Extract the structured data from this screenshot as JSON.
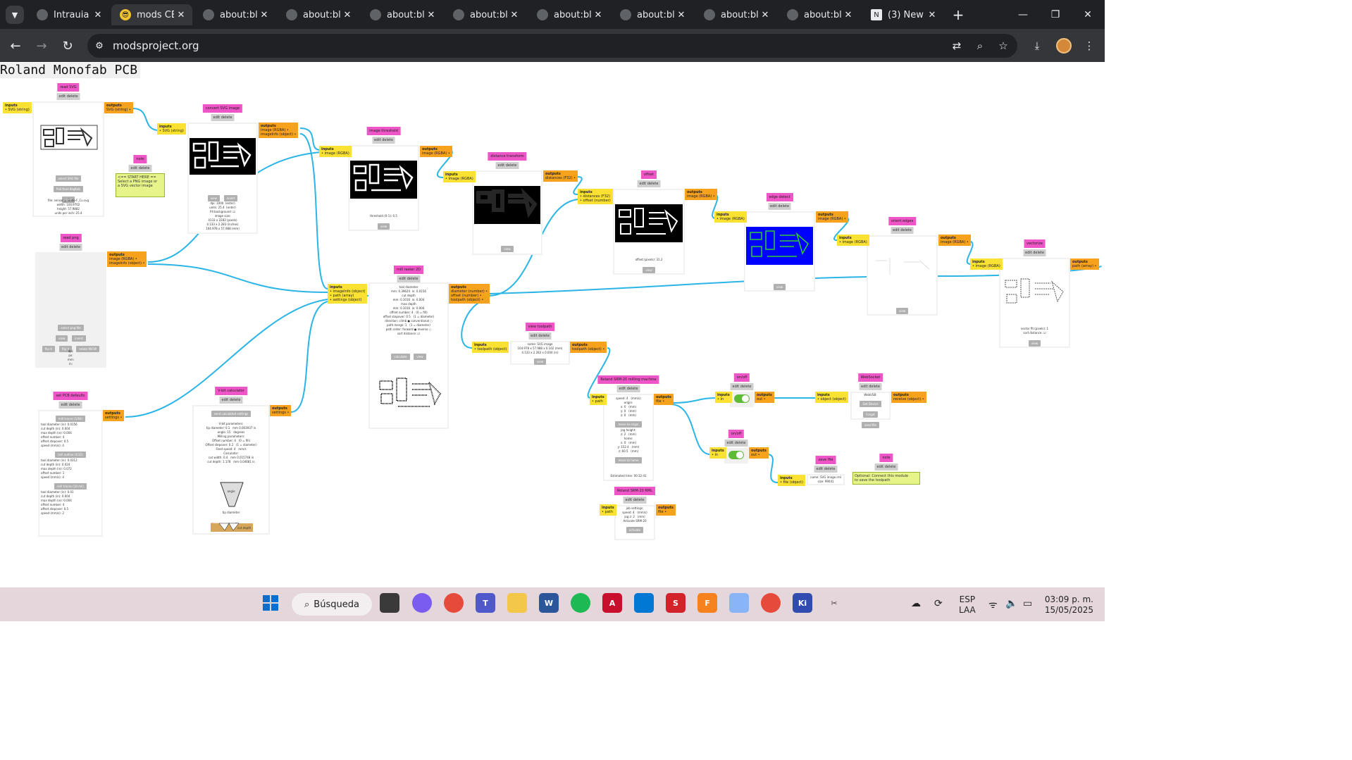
{
  "browser": {
    "tabs": [
      {
        "title": "Intrauia",
        "favicon": "globe-icon"
      },
      {
        "title": "mods CE",
        "favicon": "sunglasses-emoji-icon"
      },
      {
        "title": "about:bl",
        "favicon": "globe-icon"
      },
      {
        "title": "about:bl",
        "favicon": "globe-icon"
      },
      {
        "title": "about:bl",
        "favicon": "globe-icon"
      },
      {
        "title": "about:bl",
        "favicon": "globe-icon"
      },
      {
        "title": "about:bl",
        "favicon": "globe-icon"
      },
      {
        "title": "about:bl",
        "favicon": "globe-icon"
      },
      {
        "title": "about:bl",
        "favicon": "globe-icon"
      },
      {
        "title": "about:bl",
        "favicon": "globe-icon"
      },
      {
        "title": "(3) New",
        "favicon": "notion-icon"
      }
    ],
    "active_tab": 1,
    "url": "modsproject.org"
  },
  "page": {
    "title": "Roland Monofab PCB",
    "modules": {
      "read_svg": {
        "name": "read SVG",
        "edit": "edit delete",
        "in_hd": "inputs",
        "in_port": "• SVG (string)",
        "out_hd": "outputs",
        "out_port": "SVG (string) •",
        "btn1": "select SVG file",
        "btn2": "Pull from KegKab",
        "btn3": "view",
        "info": "file: sensor_y Sledo-F_Cu.svg\nwidth: 104.9702\nheight: 57.9882\nunits per inch: 25.4"
      },
      "note": {
        "name": "note",
        "edit": "edit delete",
        "text": "<== START HERE ==\nSelect a PNG image or\na SVG vector image"
      },
      "convert_svg": {
        "name": "convert SVG image",
        "edit": "edit delete",
        "in_hd": "inputs",
        "in_port": "• SVG (string)",
        "out_hd": "outputs",
        "out_port": "image (RGBA) •\nimageInfo (object) •",
        "btn1": "view",
        "btn2": "invert",
        "info": "dpi: 1000  (enter)\nunits: 25.4  (enter)\nfill background: ☑\nimage size:\n4133 x 2283 (pixels)\n4.133 x 2.283 (inches)\n104.978 x 57.988 (mm)"
      },
      "image_threshold": {
        "name": "image threshold",
        "edit": "edit delete",
        "in_hd": "inputs",
        "in_port": "• image (RGBA)",
        "out_hd": "outputs",
        "out_port": "image (RGBA) •",
        "info": "threshold (0-1): 0.5",
        "btn": "view"
      },
      "distance_transform": {
        "name": "distance transform",
        "edit": "edit delete",
        "in_hd": "inputs",
        "in_port": "• image (RGBA)",
        "out_hd": "outputs",
        "out_port": "distances (F32) •",
        "btn": "view"
      },
      "offset": {
        "name": "offset",
        "edit": "edit delete",
        "in_hd": "inputs",
        "in_port": "• distances (F32)\n• offset (number)",
        "out_hd": "outputs",
        "out_port": "image (RGBA) •",
        "info": "offset (pixels): 31.2",
        "btn": "view"
      },
      "edge_detect": {
        "name": "edge detect",
        "edit": "edit delete",
        "in_hd": "inputs",
        "in_port": "• image (RGBA)",
        "out_hd": "outputs",
        "out_port": "image (RGBA) •",
        "btn": "view"
      },
      "orient_edges": {
        "name": "orient edges",
        "edit": "edit delete",
        "in_hd": "inputs",
        "in_port": "• image (RGBA)",
        "out_hd": "outputs",
        "out_port": "image (RGBA) •",
        "btn": "view"
      },
      "vectorize": {
        "name": "vectorize",
        "edit": "edit delete",
        "in_hd": "inputs",
        "in_port": "• image (RGBA)",
        "out_hd": "outputs",
        "out_port": "path (array) •",
        "info": "vector fit (pixels): 1\nsort distance: ☑",
        "btn": "view"
      },
      "read_png": {
        "name": "read png",
        "edit": "edit delete",
        "out_hd": "outputs",
        "out_port": "image (RGBA) •\nimageInfo (object) •",
        "btn1": "select png file",
        "btn2": "view",
        "btn3": "invert",
        "btn4": "flip H",
        "btn5": "flip V",
        "btn6": "rotate 90CW",
        "info": "dpi:\npx:\nmm:\nin:"
      },
      "mill_raster": {
        "name": "mill raster 2D",
        "edit": "edit delete",
        "in_hd": "inputs",
        "in_port": "• imageInfo (object)\n• path (array)\n• settings (object)",
        "out_hd": "outputs",
        "out_port": "diameter (number) •\noffset (number) •\ntoolpath (object) •",
        "info": "tool diameter\nmm: 0.39624  in: 0.0156\ncut depth\nmm: 0.1016  in: 0.004\nmax depth\nmm: 0.1016  in: 0.004\noffset number: 4   (0 = fill)\noffset stepover: 0.5   (1 = diameter)\ndirection: climb ● conventional ○\npath merge: 1   (1 = diameter)\npath order: forward ● reverse ○\nsort distance: ☑",
        "btn1": "calculate",
        "btn2": "view"
      },
      "view_toolpath": {
        "name": "view toolpath",
        "edit": "edit delete",
        "in_hd": "inputs",
        "in_port": "• toolpath (object)",
        "out_hd": "outputs",
        "out_port": "toolpath (object) •",
        "info": "name: SVG image\n104.978 x 57.988 x 0.102 (mm)\n4.133 x 2.283 x 0.004 (in)",
        "btn": "view"
      },
      "set_pcb": {
        "name": "set PCB defaults",
        "edit": "edit delete",
        "out_hd": "outputs",
        "out_port": "settings •",
        "btn1": "mill traces (1/64)",
        "info1": "tool diameter (in): 0.0156\ncut depth (in): 0.004\nmax depth (in): 0.004\noffset number: 4\noffset stepover: 0.5\nspeed (mm/s): 4",
        "btn2": "mill outline (1/32)",
        "info2": "tool diameter (in): 0.0312\ncut depth (in): 0.024\nmax depth (in): 0.072\noffset number: 1\nspeed (mm/s): 4",
        "btn3": "mill traces (10 mil)",
        "info3": "tool diameter (in): 0.01\ncut depth (in): 0.004\nmax depth (in): 0.004\noffset number: 4\noffset stepover: 0.5\nspeed (mm/s): 2"
      },
      "vbit": {
        "name": "V-bit calculator",
        "edit": "edit delete",
        "out_hd": "outputs",
        "out_port": "settings •",
        "btn": "send calculated settings",
        "info": "V-bit parameters:\ntip diameter: 0.1   mm 0.003937 in\nangle: 15   degrees\nMilling parameters:\nOffset number: 4   (0 = fill)\nOffset stepover: 0.2   (1 = diameter)\nFeed speed: 4   mm/s\nCalculator:\ncut width: 0.4   mm 0.015748 in\ncut depth: 1.178   mm 0.04681 in",
        "fig_angle": "angle",
        "fig_tip": "tip diameter",
        "fig_stepover": "stepover",
        "fig_cutwidth": "cut width",
        "fig_cutdepth": "cut depth"
      },
      "roland": {
        "name": "Roland SRM-20 milling machine",
        "edit": "edit delete",
        "in_hd": "inputs",
        "in_port": "• path",
        "out_hd": "outputs",
        "out_port": "file •",
        "info": "speed: 4   (mm/s)\norigin:\nx: 0   (mm)\ny: 0   (mm)\nz: 0   (mm)",
        "btn1": "move to origin",
        "info2": "jog height:\nz: 2   (mm)\nhome:\nx: 0   (mm)\ny: 152.4   (mm)\nz: 60.5   (mm)",
        "btn2": "move to home",
        "time": "Estimated time: 00:32:41"
      },
      "roland_rml": {
        "name": "Roland SRM-20 RML",
        "edit": "edit delete",
        "in_hd": "inputs",
        "in_port": "• path",
        "out_hd": "outputs",
        "out_port": "file •",
        "info": "job settings:\nspeed: 4   (mm/s)\njog z: 2   (mm)\nActivate SRM-20",
        "btn": "activate"
      },
      "on_off_1": {
        "name": "on/off",
        "edit": "edit delete",
        "in_hd": "inputs",
        "in_port": "• in",
        "out_hd": "outputs",
        "out_port": "out •"
      },
      "on_off_2": {
        "name": "on/off",
        "edit": "edit delete",
        "in_hd": "inputs",
        "in_port": "• in",
        "out_hd": "outputs",
        "out_port": "out •"
      },
      "websocket": {
        "name": "WebSocket",
        "edit": "edit delete",
        "in_hd": "inputs",
        "in_port": "• object (object)",
        "out_hd": "outputs",
        "out_port": "receive (object) •",
        "info": "WebUSB:",
        "btn1": "Get Device",
        "btn2": "Forget",
        "btn3": "send file"
      },
      "save_file": {
        "name": "save file",
        "edit": "edit delete",
        "in_hd": "inputs",
        "in_port": "• file (object)",
        "info": "name: SVG image.rml\nsize: 99041"
      },
      "note2": {
        "name": "note",
        "edit": "edit delete",
        "text": "Optional: Connect this module\nto save the toolpath"
      }
    }
  },
  "taskbar": {
    "search_label": "Búsqueda",
    "apps": [
      "task-view-icon",
      "copilot-icon",
      "chrome-icon",
      "teams-icon",
      "file-explorer-icon",
      "word-icon",
      "spotify-icon",
      "autocad-icon",
      "vscode-icon",
      "solidworks-icon",
      "fusion-icon",
      "gemini-icon",
      "chrome-profile-icon",
      "kicad-icon",
      "snipping-tool-icon"
    ],
    "lang_1": "ESP",
    "lang_2": "LAA",
    "time": "03:09 p. m.",
    "date": "15/05/2025"
  },
  "colors": {
    "chrome_dark": "#202124",
    "toolbar": "#35363a",
    "module_name": "#ee55c7",
    "input_port": "#fbe232",
    "output_port": "#f7a21d",
    "wire": "#2ab5e6",
    "edge_detect_bg": "#0000ff",
    "edge_detect_fg": "#33cc33"
  }
}
